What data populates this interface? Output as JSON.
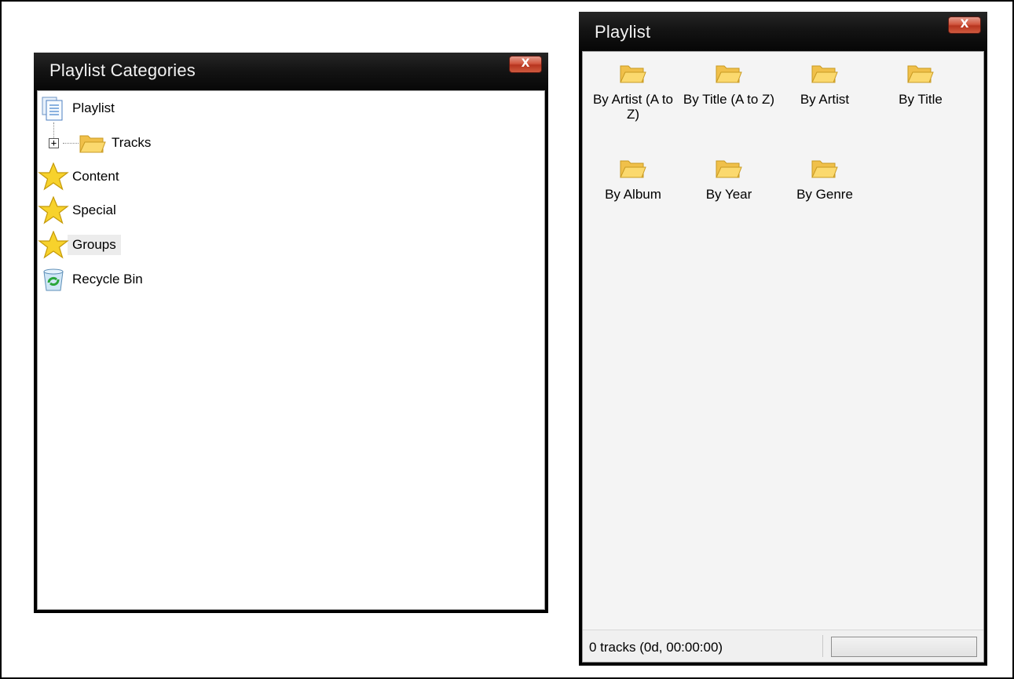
{
  "colors": {
    "titlebar": "#141414",
    "close_button": "#c9482f",
    "folder": "#f4c24a",
    "star": "#f7d22c",
    "selection": "#ececec"
  },
  "left_window": {
    "title": "Playlist Categories",
    "close_label": "X",
    "tree": [
      {
        "label": "Playlist",
        "icon": "document-icon"
      },
      {
        "label": "Tracks",
        "icon": "folder-icon",
        "expandable": true,
        "expander": "+"
      },
      {
        "label": "Content",
        "icon": "star-icon"
      },
      {
        "label": "Special",
        "icon": "star-icon"
      },
      {
        "label": "Groups",
        "icon": "star-icon",
        "selected": true
      },
      {
        "label": "Recycle Bin",
        "icon": "recycle-bin-icon"
      }
    ]
  },
  "right_window": {
    "title": "Playlist",
    "close_label": "X",
    "items": [
      {
        "label": "By Artist (A to Z)",
        "icon": "folder-icon"
      },
      {
        "label": "By Title (A to Z)",
        "icon": "folder-icon"
      },
      {
        "label": "By Artist",
        "icon": "folder-icon"
      },
      {
        "label": "By Title",
        "icon": "folder-icon"
      },
      {
        "label": "By Album",
        "icon": "folder-icon"
      },
      {
        "label": "By Year",
        "icon": "folder-icon"
      },
      {
        "label": "By Genre",
        "icon": "folder-icon"
      }
    ],
    "status": {
      "text": "0 tracks (0d, 00:00:00)",
      "progress": 0
    }
  }
}
